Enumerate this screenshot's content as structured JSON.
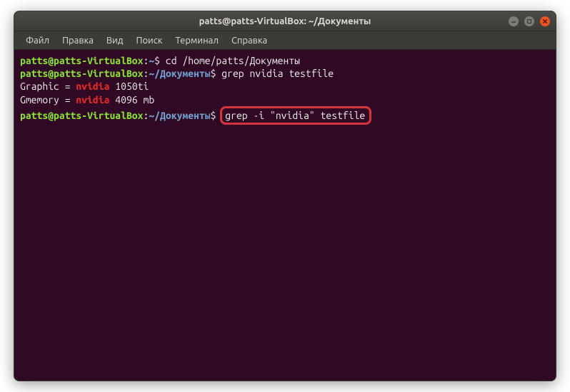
{
  "window": {
    "title": "patts@patts-VirtualBox: ~/Документы"
  },
  "menubar": {
    "items": [
      "Файл",
      "Правка",
      "Вид",
      "Поиск",
      "Терминал",
      "Справка"
    ]
  },
  "terminal": {
    "lines": [
      {
        "type": "prompt",
        "user": "patts@patts-VirtualBox",
        "colon": ":",
        "path": "~",
        "sep": "$ ",
        "cmd": "cd /home/patts/Документы"
      },
      {
        "type": "prompt",
        "user": "patts@patts-VirtualBox",
        "colon": ":",
        "path": "~/Документы",
        "sep": "$ ",
        "cmd": "grep nvidia testfile"
      },
      {
        "type": "output",
        "pre": "Graphic = ",
        "match": "nvidia",
        "post": " 1050ti"
      },
      {
        "type": "output",
        "pre": "Gmemory = ",
        "match": "nvidia",
        "post": " 4096 mb"
      },
      {
        "type": "prompt-highlight",
        "user": "patts@patts-VirtualBox",
        "colon": ":",
        "path": "~/Документы",
        "sep": "$ ",
        "cmd": "grep -i \"nvidia\" testfile"
      }
    ]
  }
}
